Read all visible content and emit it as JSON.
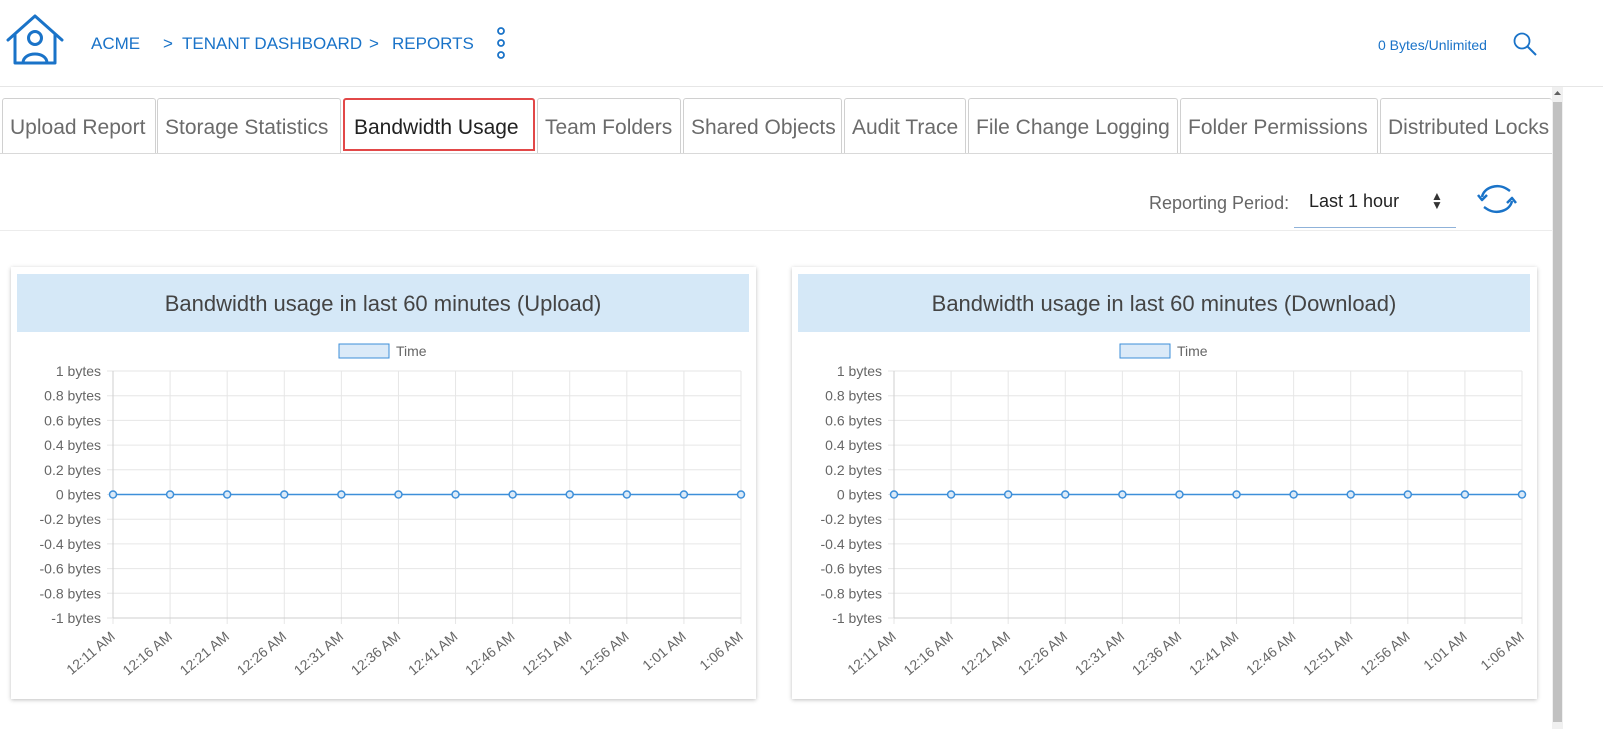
{
  "header": {
    "breadcrumb": {
      "home": "ACME",
      "sep1": ">",
      "dashboard": "TENANT DASHBOARD",
      "sep2": ">",
      "reports": "REPORTS"
    },
    "quota": "0 Bytes/Unlimited",
    "icons": [
      "home-icon",
      "kebab-menu-icon",
      "search-icon"
    ]
  },
  "tabs": [
    {
      "label": "Upload Report",
      "active": false
    },
    {
      "label": "Storage Statistics",
      "active": false
    },
    {
      "label": "Bandwidth Usage",
      "active": true
    },
    {
      "label": "Team Folders",
      "active": false
    },
    {
      "label": "Shared Objects",
      "active": false
    },
    {
      "label": "Audit Trace",
      "active": false
    },
    {
      "label": "File Change Logging",
      "active": false
    },
    {
      "label": "Folder Permissions",
      "active": false
    },
    {
      "label": "Distributed Locks",
      "active": false
    }
  ],
  "toolbar": {
    "period_label": "Reporting Period:",
    "period_value": "Last 1 hour",
    "refresh_icon": "refresh-icon"
  },
  "colors": {
    "accent": "#1a73c8",
    "title_bg": "#d5e8f7",
    "active_tab_border": "#e24848",
    "series_line": "#3d8fd9",
    "legend_fill": "#dbeaf8"
  },
  "chart_data": [
    {
      "type": "line",
      "title": "Bandwidth usage in last 60 minutes (Upload)",
      "legend": "Time",
      "x": [
        "12:11 AM",
        "12:16 AM",
        "12:21 AM",
        "12:26 AM",
        "12:31 AM",
        "12:36 AM",
        "12:41 AM",
        "12:46 AM",
        "12:51 AM",
        "12:56 AM",
        "1:01 AM",
        "1:06 AM"
      ],
      "series": [
        {
          "name": "Time",
          "values": [
            0,
            0,
            0,
            0,
            0,
            0,
            0,
            0,
            0,
            0,
            0,
            0
          ]
        }
      ],
      "yticks": [
        "1 bytes",
        "0.8 bytes",
        "0.6 bytes",
        "0.4 bytes",
        "0.2 bytes",
        "0 bytes",
        "-0.2 bytes",
        "-0.4 bytes",
        "-0.6 bytes",
        "-0.8 bytes",
        "-1 bytes"
      ],
      "ylim": [
        -1,
        1
      ],
      "grid": true
    },
    {
      "type": "line",
      "title": "Bandwidth usage in last 60 minutes (Download)",
      "legend": "Time",
      "x": [
        "12:11 AM",
        "12:16 AM",
        "12:21 AM",
        "12:26 AM",
        "12:31 AM",
        "12:36 AM",
        "12:41 AM",
        "12:46 AM",
        "12:51 AM",
        "12:56 AM",
        "1:01 AM",
        "1:06 AM"
      ],
      "series": [
        {
          "name": "Time",
          "values": [
            0,
            0,
            0,
            0,
            0,
            0,
            0,
            0,
            0,
            0,
            0,
            0
          ]
        }
      ],
      "yticks": [
        "1 bytes",
        "0.8 bytes",
        "0.6 bytes",
        "0.4 bytes",
        "0.2 bytes",
        "0 bytes",
        "-0.2 bytes",
        "-0.4 bytes",
        "-0.6 bytes",
        "-0.8 bytes",
        "-1 bytes"
      ],
      "ylim": [
        -1,
        1
      ],
      "grid": true
    }
  ]
}
